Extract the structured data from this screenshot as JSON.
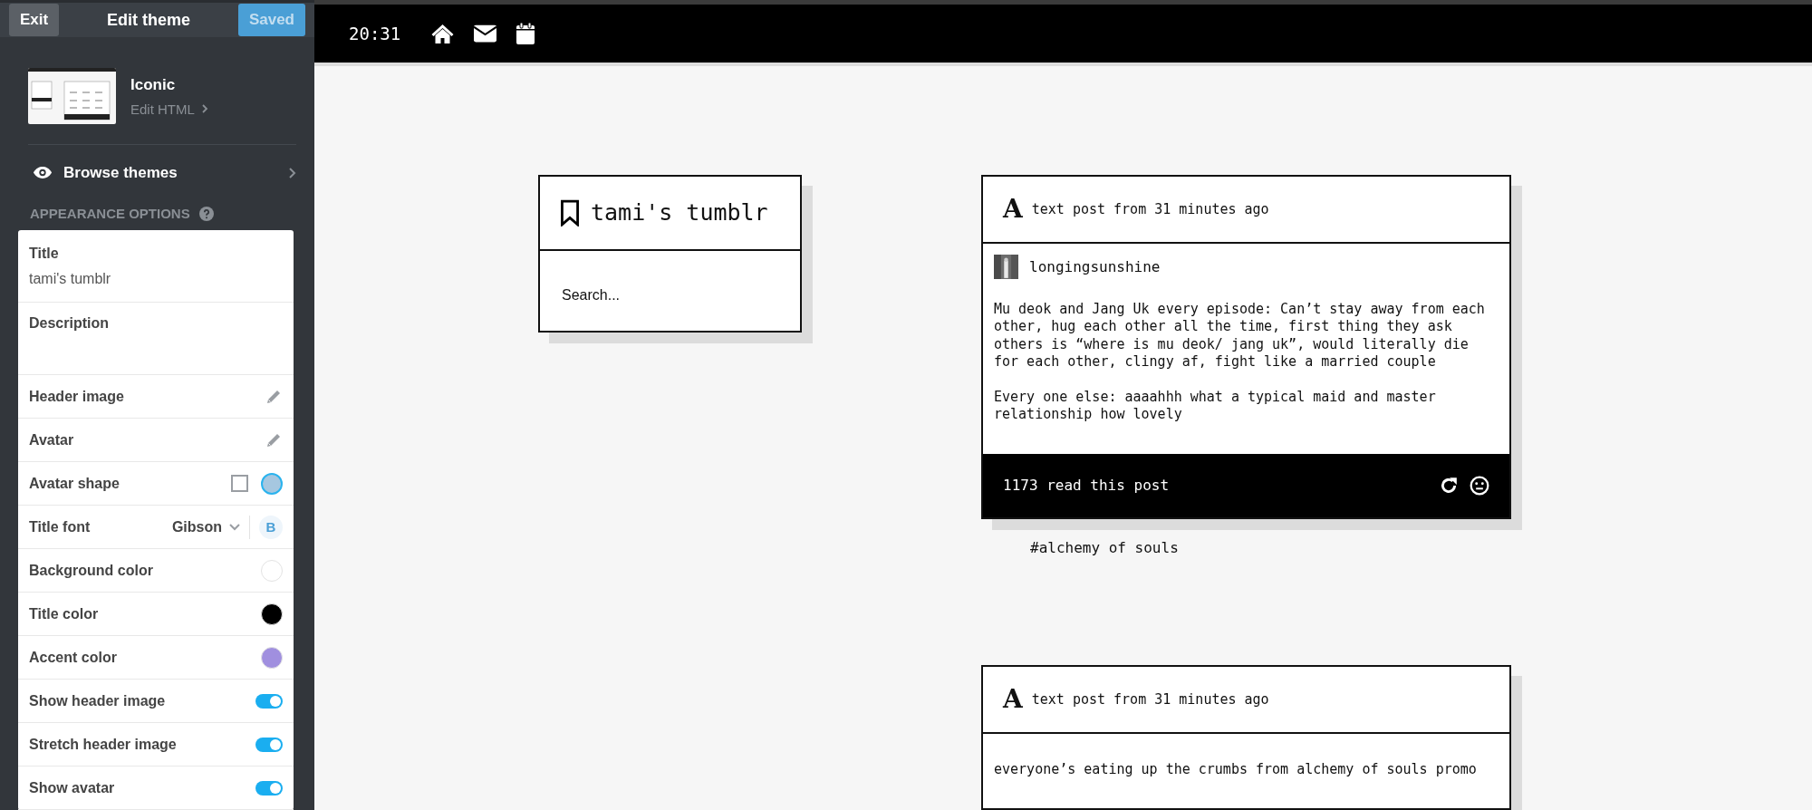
{
  "editor": {
    "exit_button": "Exit",
    "title": "Edit theme",
    "save_button": "Saved",
    "theme": {
      "name": "Iconic",
      "edit_link": "Edit HTML"
    },
    "browse": "Browse themes",
    "section": "APPEARANCE OPTIONS",
    "options": [
      {
        "kind": "text",
        "label": "Title",
        "value": "tami's tumblr"
      },
      {
        "kind": "textarea",
        "label": "Description"
      },
      {
        "label": "Header image"
      },
      {
        "label": "Avatar"
      },
      {
        "kind": "shape",
        "label": "Avatar shape",
        "shapes": [
          {
            "kind": "square",
            "selected": false
          },
          {
            "kind": "circle",
            "selected": true
          }
        ]
      },
      {
        "kind": "font",
        "label": "Title font",
        "value": "Gibson",
        "bold_label": "B",
        "bold": true
      },
      {
        "kind": "color",
        "label": "Background color",
        "color": "#ffffff"
      },
      {
        "kind": "color",
        "label": "Title color",
        "color": "#000000"
      },
      {
        "kind": "color",
        "label": "Accent color",
        "color": "#a08fdf"
      },
      {
        "kind": "toggle",
        "label": "Show header image",
        "on": true
      },
      {
        "kind": "toggle",
        "label": "Stretch header image",
        "on": true
      },
      {
        "kind": "toggle",
        "label": "Show avatar",
        "on": true
      }
    ]
  },
  "topbar": {
    "time": "20:31"
  },
  "blog": {
    "title": "tami's tumblr",
    "search": {
      "placeholder": "Search..."
    }
  },
  "posts": [
    {
      "type_icon": "A",
      "meta": "text post from 31 minutes ago",
      "author": "longingsunshine",
      "paragraphs": [
        "Mu deok and Jang Uk every episode: Can’t stay away from each other, hug each other all the time, first thing they ask others is “where is mu deok/ jang uk”, would literally die for each other, clingy af, fight like a married couple",
        "Every one else: aaaahhh what a typical maid and master relationship how lovely"
      ],
      "notes": "1173 read this post",
      "tags": [
        "#alchemy of souls"
      ]
    },
    {
      "type_icon": "A",
      "meta": "text post from 31 minutes ago",
      "paragraphs": [
        "everyone’s eating up the crumbs from alchemy of souls promo"
      ]
    }
  ]
}
